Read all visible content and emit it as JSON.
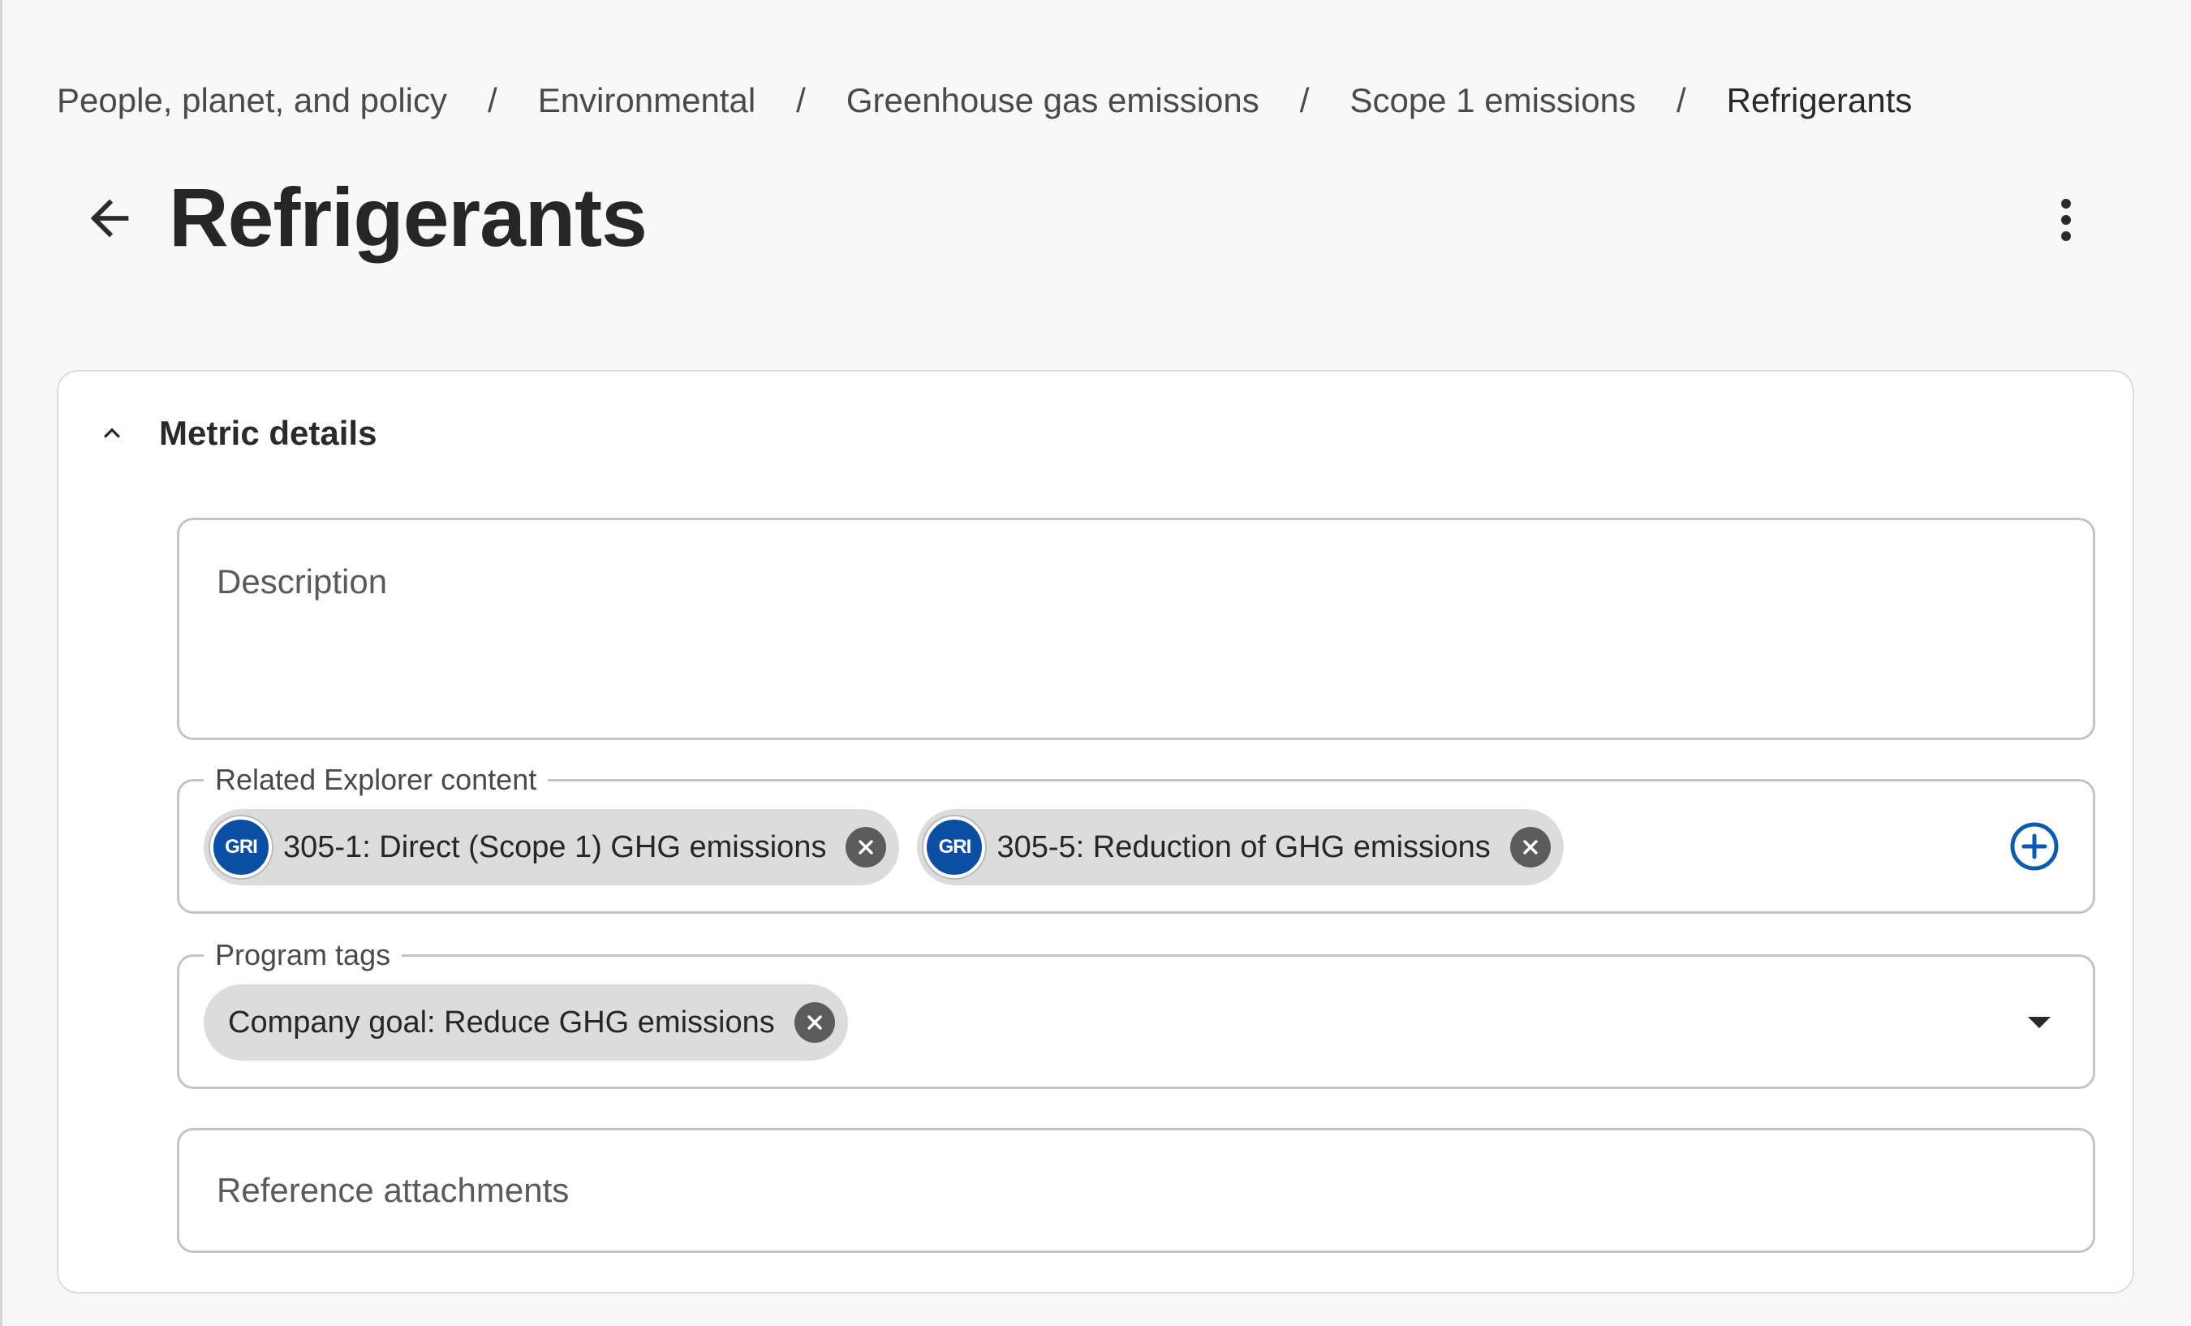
{
  "breadcrumb": {
    "items": [
      "People, planet, and policy",
      "Environmental",
      "Greenhouse gas emissions",
      "Scope 1 emissions",
      "Refrigerants"
    ],
    "separator": "/"
  },
  "page": {
    "title": "Refrigerants",
    "back_icon": "arrow-left-icon",
    "more_icon": "more-vertical-icon"
  },
  "metric_details": {
    "title": "Metric details",
    "description": {
      "placeholder": "Description"
    },
    "related_content": {
      "label": "Related Explorer content",
      "chips": [
        {
          "badge": "GRI",
          "label": "305-1: Direct (Scope 1) GHG emissions"
        },
        {
          "badge": "GRI",
          "label": "305-5: Reduction of GHG emissions"
        }
      ]
    },
    "program_tags": {
      "label": "Program tags",
      "chips": [
        {
          "label": "Company goal: Reduce GHG emissions"
        }
      ]
    },
    "attachments": {
      "placeholder": "Reference attachments"
    }
  },
  "colors": {
    "gri_blue": "#0b4ea2",
    "add_blue": "#0b5cad",
    "chip_bg": "#dcdcdc",
    "chip_remove": "#5c5c5c"
  }
}
